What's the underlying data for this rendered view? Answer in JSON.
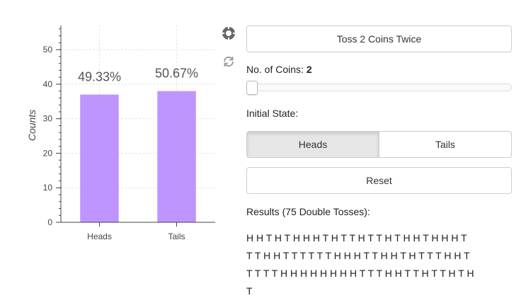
{
  "toolbar": {
    "wheel_icon": "wheel-zoom-icon",
    "reset_icon": "reset-icon"
  },
  "controls": {
    "toss_button_label": "Toss 2 Coins Twice",
    "coins_label": "No. of Coins:",
    "coins_value": "2",
    "slider_value": 2,
    "slider_min": 2,
    "slider_max": 10,
    "initial_state_label": "Initial State:",
    "initial_state_options": [
      "Heads",
      "Tails"
    ],
    "initial_state_selected": "Heads",
    "reset_button_label": "Reset",
    "results_label": "Results (75 Double Tosses):",
    "results_lines": [
      "H H T H T H H H T H T T H T T H T H H T H H H T",
      "T T H H T T T T T T H H H T T H H T H T T T H H T",
      "T T T T H H H H H H H H T T T H H T T H T T H T H",
      "T"
    ]
  },
  "colors": {
    "bar": "#bf94ff",
    "grid": "#e5e5e5",
    "axis": "#444444"
  },
  "chart_data": {
    "type": "bar",
    "categories": [
      "Heads",
      "Tails"
    ],
    "values": [
      37,
      38
    ],
    "labels": [
      "49.33%",
      "50.67%"
    ],
    "title": "",
    "xlabel": "",
    "ylabel": "Counts",
    "ylim": [
      0,
      57
    ],
    "yticks": [
      0,
      10,
      20,
      30,
      40,
      50
    ],
    "grid": true
  }
}
